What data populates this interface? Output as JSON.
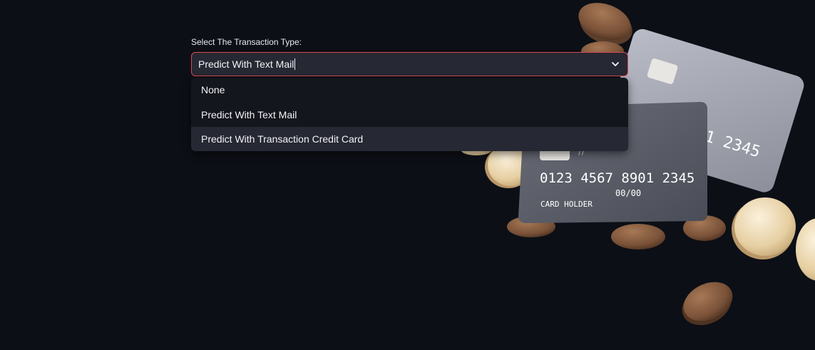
{
  "form": {
    "label": "Select The Transaction Type:",
    "selected_value": "Predict With Text Mail",
    "options": [
      {
        "label": "None",
        "highlighted": false
      },
      {
        "label": "Predict With Text Mail",
        "highlighted": false
      },
      {
        "label": "Predict With Transaction Credit Card",
        "highlighted": true
      }
    ]
  },
  "icons": {
    "dropdown_toggle": "chevron-down-icon"
  },
  "background": {
    "front_card": {
      "number": "0123 4567 8901 2345",
      "expiry": "00/00",
      "holder": "CARD HOLDER"
    },
    "back_card": {
      "number_fragment": "01 2345",
      "fragment_line2": "0"
    }
  },
  "colors": {
    "page_bg": "#0c0f16",
    "input_bg": "#262833",
    "focus_border": "#d9494f",
    "dropdown_bg": "#14161e",
    "highlight_bg": "#262833",
    "text": "#f4f4f6"
  }
}
